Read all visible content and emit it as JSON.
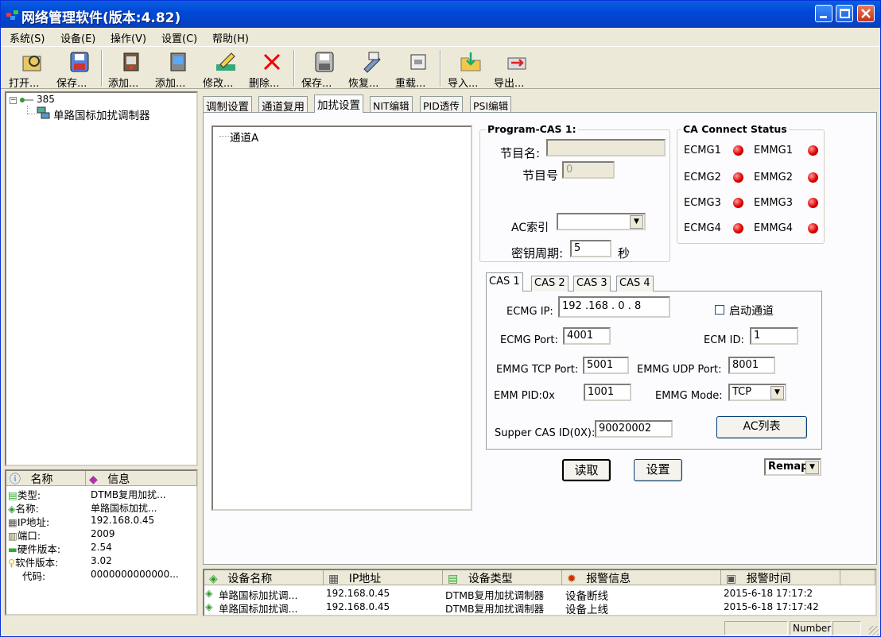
{
  "window": {
    "title": "网络管理软件(版本:4.82)"
  },
  "menu": [
    "系统(S)",
    "设备(E)",
    "操作(V)",
    "设置(C)",
    "帮助(H)"
  ],
  "toolbar": [
    {
      "label": "打开...",
      "icon": "open-icon"
    },
    {
      "label": "保存...",
      "icon": "save-icon"
    },
    {
      "label": "添加...",
      "icon": "add-icon"
    },
    {
      "label": "添加...",
      "icon": "add-icon"
    },
    {
      "label": "修改...",
      "icon": "edit-icon"
    },
    {
      "label": "删除...",
      "icon": "delete-icon"
    },
    {
      "label": "保存...",
      "icon": "save-icon"
    },
    {
      "label": "恢复...",
      "icon": "restore-icon"
    },
    {
      "label": "重载...",
      "icon": "reload-icon"
    },
    {
      "label": "导入...",
      "icon": "import-icon"
    },
    {
      "label": "导出...",
      "icon": "export-icon"
    }
  ],
  "device_tree": {
    "root": "385",
    "child": "单路国标加扰调制器"
  },
  "info_panel": {
    "headers": [
      "名称",
      "信息"
    ],
    "rows": [
      {
        "key": "类型:",
        "value": "DTMB复用加扰..."
      },
      {
        "key": "名称:",
        "value": "单路国标加扰..."
      },
      {
        "key": "IP地址:",
        "value": "192.168.0.45"
      },
      {
        "key": "端口:",
        "value": "2009"
      },
      {
        "key": "硬件版本:",
        "value": "2.54"
      },
      {
        "key": "软件版本:",
        "value": "3.02"
      },
      {
        "key": "代码:",
        "value": "0000000000000..."
      }
    ]
  },
  "tabs": [
    "调制设置",
    "通道复用",
    "加扰设置",
    "NIT编辑",
    "PID透传",
    "PSI编辑"
  ],
  "active_tab": "加扰设置",
  "channel_tree": [
    "通道A"
  ],
  "program_cas": {
    "title": "Program-CAS 1:",
    "program_name_label": "节目名:",
    "program_name": "",
    "program_number_label": "节目号",
    "program_number": "0",
    "ac_index_label": "AC索引",
    "ac_index": "",
    "key_period_label": "密钥周期:",
    "key_period": "5",
    "key_period_unit": "秒"
  },
  "ca_status": {
    "title": "CA Connect Status",
    "items": [
      "ECMG1",
      "EMMG1",
      "ECMG2",
      "EMMG2",
      "ECMG3",
      "EMMG3",
      "ECMG4",
      "EMMG4"
    ],
    "led_color": "#e00000"
  },
  "cas_tabs": [
    "CAS 1",
    "CAS 2",
    "CAS 3",
    "CAS 4"
  ],
  "cas": {
    "ecmg_ip_label": "ECMG IP:",
    "ecmg_ip": "192 .168 .  0  .  8",
    "enable_channel_label": "启动通道",
    "ecmg_port_label": "ECMG Port:",
    "ecmg_port": "4001",
    "ecm_id_label": "ECM ID:",
    "ecm_id": "1",
    "emmg_tcp_port_label": "EMMG TCP Port:",
    "emmg_tcp_port": "5001",
    "emmg_udp_port_label": "EMMG UDP Port:",
    "emmg_udp_port": "8001",
    "emm_pid_label": "EMM PID:0x",
    "emm_pid": "1001",
    "emmg_mode_label": "EMMG Mode:",
    "emmg_mode": "TCP",
    "super_cas_id_label": "Supper CAS ID(0X):",
    "super_cas_id": "90020002",
    "ac_list_button": "AC列表"
  },
  "buttons": {
    "read": "读取",
    "set": "设置",
    "remap": "Remap"
  },
  "alarm_grid": {
    "headers": [
      "设备名称",
      "IP地址",
      "设备类型",
      "报警信息",
      "报警时间"
    ],
    "rows": [
      [
        "单路国标加扰调...",
        "192.168.0.45",
        "DTMB复用加扰调制器",
        "设备断线",
        "2015-6-18 17:17:2"
      ],
      [
        "单路国标加扰调...",
        "192.168.0.45",
        "DTMB复用加扰调制器",
        "设备上线",
        "2015-6-18 17:17:42"
      ]
    ]
  },
  "statusbar": {
    "num": "Number"
  }
}
